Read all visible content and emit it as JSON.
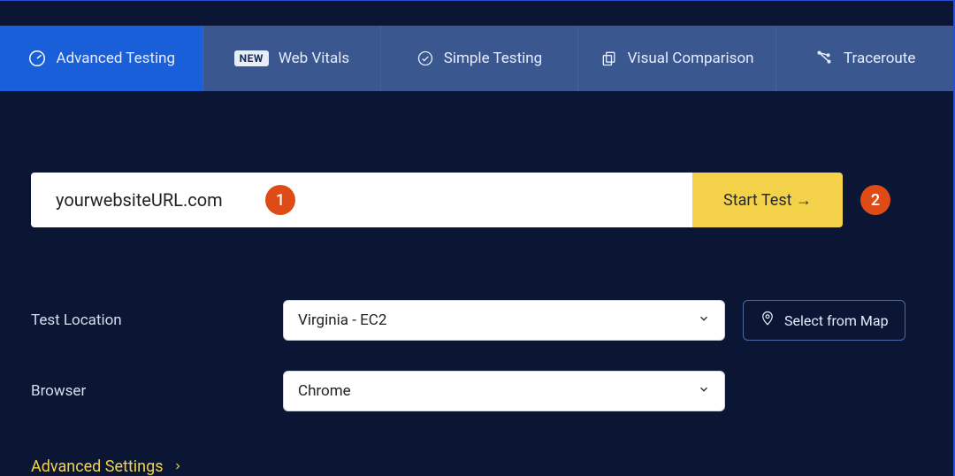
{
  "tabs": {
    "advanced": "Advanced Testing",
    "webvitals_badge": "NEW",
    "webvitals": "Web Vitals",
    "simple": "Simple Testing",
    "visual": "Visual Comparison",
    "traceroute": "Traceroute"
  },
  "url": {
    "placeholder": "yourwebsiteURL.com",
    "start_label": "Start Test →"
  },
  "markers": {
    "one": "1",
    "two": "2"
  },
  "form": {
    "location_label": "Test Location",
    "location_value": "Virginia - EC2",
    "map_button": "Select from Map",
    "browser_label": "Browser",
    "browser_value": "Chrome"
  },
  "advanced_link": "Advanced Settings"
}
